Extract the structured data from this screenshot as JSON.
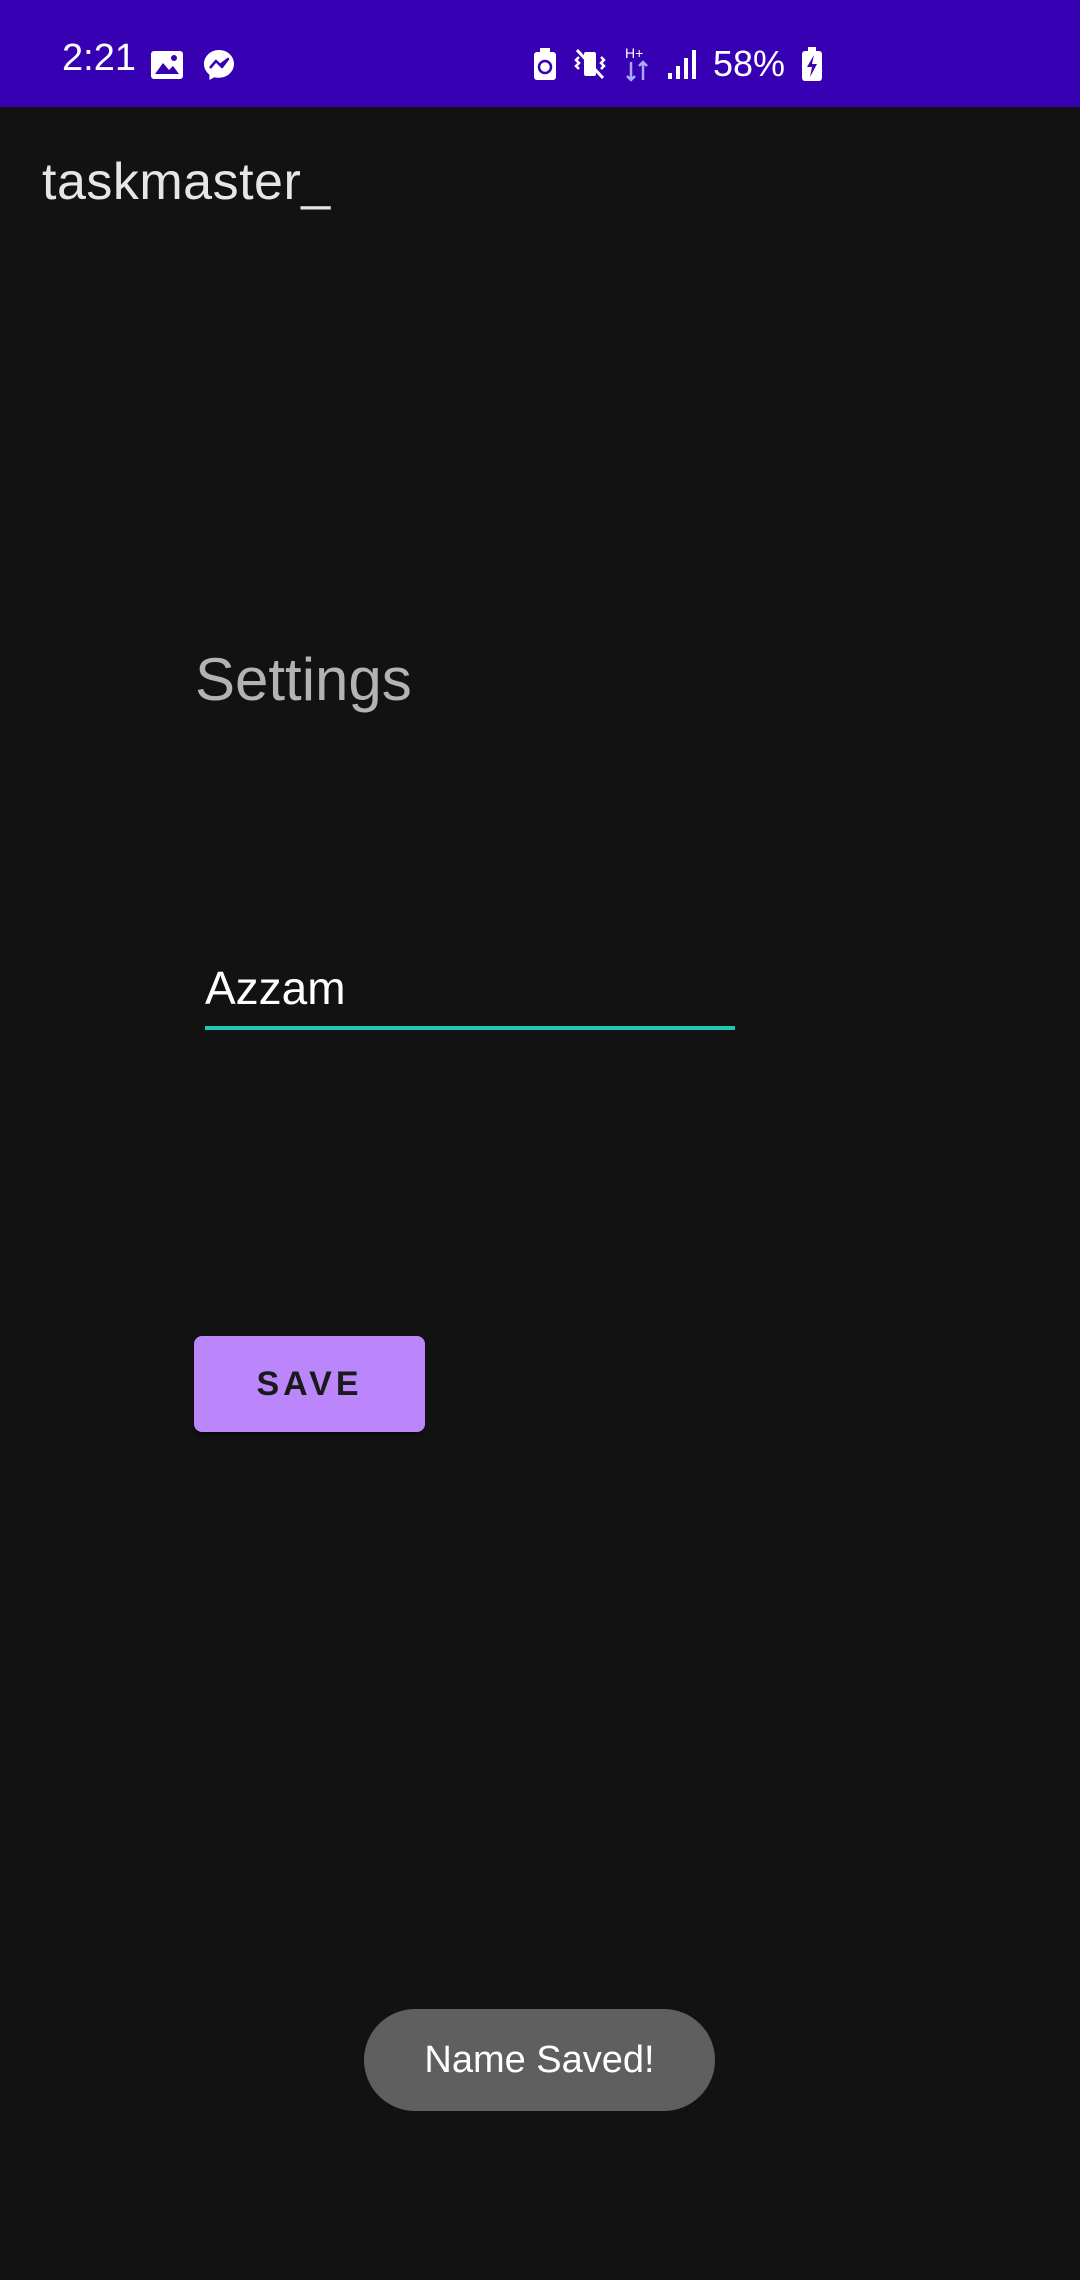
{
  "status_bar": {
    "time": "2:21",
    "battery_percent": "58%",
    "network_type": "H+",
    "left_icons": [
      "image-icon",
      "messenger-icon"
    ],
    "right_icons": [
      "battery-saver-icon",
      "vibrate-mute-icon",
      "network-type-icon",
      "signal-icon",
      "battery-charging-icon"
    ],
    "background_color": "#3700b3"
  },
  "app_bar": {
    "title": "taskmaster_"
  },
  "main": {
    "heading": "Settings",
    "name_input": {
      "value": "Azzam",
      "accent_color": "#1ec8b4"
    },
    "save_button": {
      "label": "SAVE",
      "color": "#bb86fc"
    }
  },
  "toast": {
    "message": "Name Saved!"
  }
}
